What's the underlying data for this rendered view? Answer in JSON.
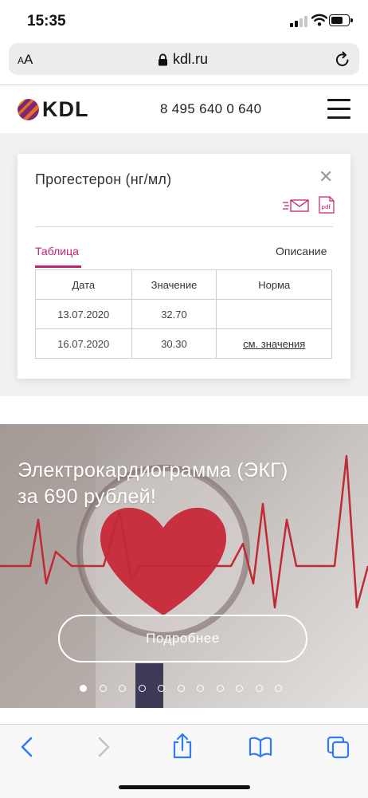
{
  "status_bar": {
    "time": "15:35"
  },
  "browser": {
    "text_size_label": "AA",
    "domain": "kdl.ru"
  },
  "site_header": {
    "logo_text": "KDL",
    "phone": "8 495 640 0 640"
  },
  "result_card": {
    "title": "Прогестерон (нг/мл)",
    "tabs": [
      {
        "label": "Таблица",
        "active": true
      },
      {
        "label": "Описание",
        "active": false
      }
    ],
    "pdf_label": "pdf",
    "table": {
      "headers": [
        "Дата",
        "Значение",
        "Норма"
      ],
      "rows": [
        [
          "13.07.2020",
          "32.70",
          ""
        ],
        [
          "16.07.2020",
          "30.30",
          "см. значения"
        ]
      ]
    }
  },
  "banner": {
    "headline_line1": "Электрокардиограмма (ЭКГ)",
    "headline_line2": "за 690 рублей!",
    "button_label": "Подробнее",
    "slide_count": 11,
    "active_slide": 1
  },
  "colors": {
    "accent": "#c0246e",
    "text": "#333333",
    "card_bg": "#ffffff",
    "page_gray": "#f1f1f1"
  },
  "icons": [
    "signal-icon",
    "wifi-icon",
    "battery-icon",
    "lock-icon",
    "reload-icon",
    "kdl-logo-icon",
    "menu-icon",
    "close-icon",
    "email-icon",
    "pdf-icon",
    "back-icon",
    "forward-icon",
    "share-icon",
    "bookmarks-icon",
    "tabs-icon"
  ]
}
